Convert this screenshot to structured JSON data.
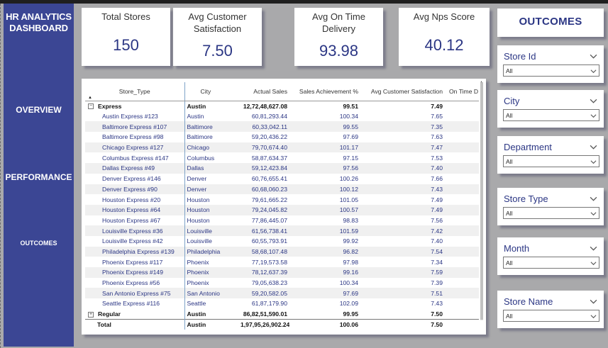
{
  "sidebar": {
    "title_line1": "HR ANALYTICS",
    "title_line2": "DASHBOARD",
    "nav": {
      "overview": "OVERVIEW",
      "performance": "PERFORMANCE",
      "outcomes": "OUTCOMES"
    }
  },
  "kpis": {
    "total_stores": {
      "label": "Total Stores",
      "value": "150"
    },
    "avg_customer_satisfaction": {
      "label_line1": "Avg Customer",
      "label_line2": "Satisfaction",
      "value": "7.50"
    },
    "avg_on_time_delivery": {
      "label_line1": "Avg On Time",
      "label_line2": "Delivery",
      "value": "93.98"
    },
    "avg_nps_score": {
      "label": "Avg Nps Score",
      "value": "40.12"
    }
  },
  "table": {
    "columns": [
      "Store_Type",
      "City",
      "Actual Sales",
      "Sales Achievement %",
      "Avg Customer Satisfaction",
      "On Time D"
    ],
    "groups": {
      "express": {
        "name": "Express",
        "city": "Austin",
        "sales": "12,72,48,627.08",
        "ach": "99.51",
        "sat": "7.49"
      },
      "regular": {
        "name": "Regular",
        "city": "Austin",
        "sales": "86,82,51,590.01",
        "ach": "99.95",
        "sat": "7.50"
      }
    },
    "rows": [
      {
        "store": "Austin Express #123",
        "city": "Austin",
        "sales": "60,81,293.44",
        "ach": "100.34",
        "sat": "7.65"
      },
      {
        "store": "Baltimore Express #107",
        "city": "Baltimore",
        "sales": "60,33,042.11",
        "ach": "99.55",
        "sat": "7.35"
      },
      {
        "store": "Baltimore Express #98",
        "city": "Baltimore",
        "sales": "59,20,436.22",
        "ach": "97.69",
        "sat": "7.63"
      },
      {
        "store": "Chicago Express #127",
        "city": "Chicago",
        "sales": "79,70,674.40",
        "ach": "101.17",
        "sat": "7.47"
      },
      {
        "store": "Columbus Express #147",
        "city": "Columbus",
        "sales": "58,87,634.37",
        "ach": "97.15",
        "sat": "7.53"
      },
      {
        "store": "Dallas Express #49",
        "city": "Dallas",
        "sales": "59,12,423.84",
        "ach": "97.56",
        "sat": "7.40"
      },
      {
        "store": "Denver Express #146",
        "city": "Denver",
        "sales": "60,76,655.41",
        "ach": "100.26",
        "sat": "7.66"
      },
      {
        "store": "Denver Express #90",
        "city": "Denver",
        "sales": "60,68,060.23",
        "ach": "100.12",
        "sat": "7.43"
      },
      {
        "store": "Houston Express #20",
        "city": "Houston",
        "sales": "79,61,665.22",
        "ach": "101.05",
        "sat": "7.49"
      },
      {
        "store": "Houston Express #64",
        "city": "Houston",
        "sales": "79,24,045.82",
        "ach": "100.57",
        "sat": "7.49"
      },
      {
        "store": "Houston Express #67",
        "city": "Houston",
        "sales": "77,86,445.07",
        "ach": "98.83",
        "sat": "7.56"
      },
      {
        "store": "Louisville Express #36",
        "city": "Louisville",
        "sales": "61,56,738.41",
        "ach": "101.59",
        "sat": "7.42"
      },
      {
        "store": "Louisville Express #42",
        "city": "Louisville",
        "sales": "60,55,793.91",
        "ach": "99.92",
        "sat": "7.40"
      },
      {
        "store": "Philadelphia Express #139",
        "city": "Philadelphia",
        "sales": "58,68,107.48",
        "ach": "96.82",
        "sat": "7.54"
      },
      {
        "store": "Phoenix Express #117",
        "city": "Phoenix",
        "sales": "77,19,573.58",
        "ach": "97.98",
        "sat": "7.34"
      },
      {
        "store": "Phoenix Express #149",
        "city": "Phoenix",
        "sales": "78,12,637.39",
        "ach": "99.16",
        "sat": "7.59"
      },
      {
        "store": "Phoenix Express #56",
        "city": "Phoenix",
        "sales": "79,05,638.23",
        "ach": "100.34",
        "sat": "7.39"
      },
      {
        "store": "San Antonio Express #75",
        "city": "San Antonio",
        "sales": "59,20,582.05",
        "ach": "97.69",
        "sat": "7.51"
      },
      {
        "store": "Seattle Express #116",
        "city": "Seattle",
        "sales": "61,87,179.90",
        "ach": "102.09",
        "sat": "7.43"
      }
    ],
    "total": {
      "label": "Total",
      "city": "Austin",
      "sales": "1,97,95,26,902.24",
      "ach": "100.06",
      "sat": "7.50"
    }
  },
  "outcomes_title": "OUTCOMES",
  "slicers": [
    {
      "title": "Store Id",
      "value": "All"
    },
    {
      "title": "City",
      "value": "All"
    },
    {
      "title": "Department",
      "value": "All"
    },
    {
      "title": "Store Type",
      "value": "All"
    },
    {
      "title": "Month",
      "value": "All"
    },
    {
      "title": "Store Name",
      "value": "All"
    }
  ]
}
